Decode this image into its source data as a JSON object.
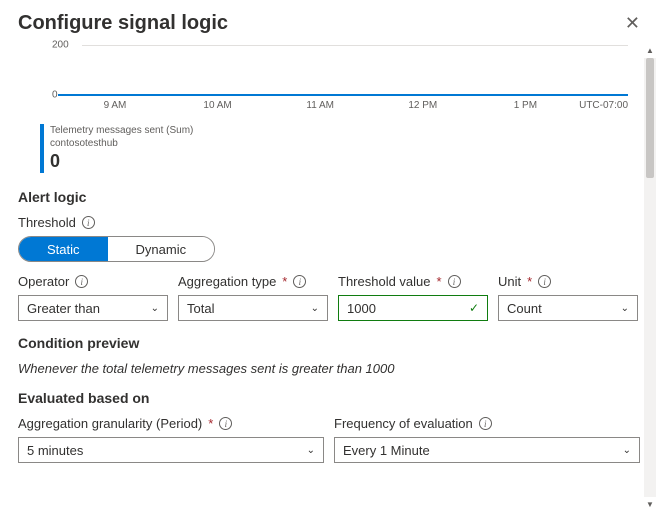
{
  "header": {
    "title": "Configure signal logic"
  },
  "chart_data": {
    "type": "line",
    "ylabels": [
      "200",
      "0"
    ],
    "ylim": [
      0,
      200
    ],
    "xlabels": [
      "9 AM",
      "10 AM",
      "11 AM",
      "12 PM",
      "1 PM"
    ],
    "timezone": "UTC-07:00",
    "series": [
      {
        "name": "Telemetry messages sent (Sum)",
        "values": [
          0,
          0,
          0,
          0,
          0
        ]
      }
    ],
    "legend": {
      "metric": "Telemetry messages sent (Sum)",
      "resource": "contosotesthub",
      "value": "0"
    }
  },
  "alert_logic": {
    "heading": "Alert logic",
    "threshold": {
      "label": "Threshold",
      "options": {
        "static": "Static",
        "dynamic": "Dynamic"
      },
      "selected": "static"
    },
    "operator": {
      "label": "Operator",
      "value": "Greater than"
    },
    "aggregation_type": {
      "label": "Aggregation type",
      "value": "Total"
    },
    "threshold_value": {
      "label": "Threshold value",
      "value": "1000"
    },
    "unit": {
      "label": "Unit",
      "value": "Count"
    },
    "condition_preview": {
      "label": "Condition preview",
      "text": "Whenever the total telemetry messages sent is greater than 1000"
    },
    "evaluated": {
      "heading": "Evaluated based on",
      "granularity": {
        "label": "Aggregation granularity (Period)",
        "value": "5 minutes"
      },
      "frequency": {
        "label": "Frequency of evaluation",
        "value": "Every 1 Minute"
      }
    }
  }
}
